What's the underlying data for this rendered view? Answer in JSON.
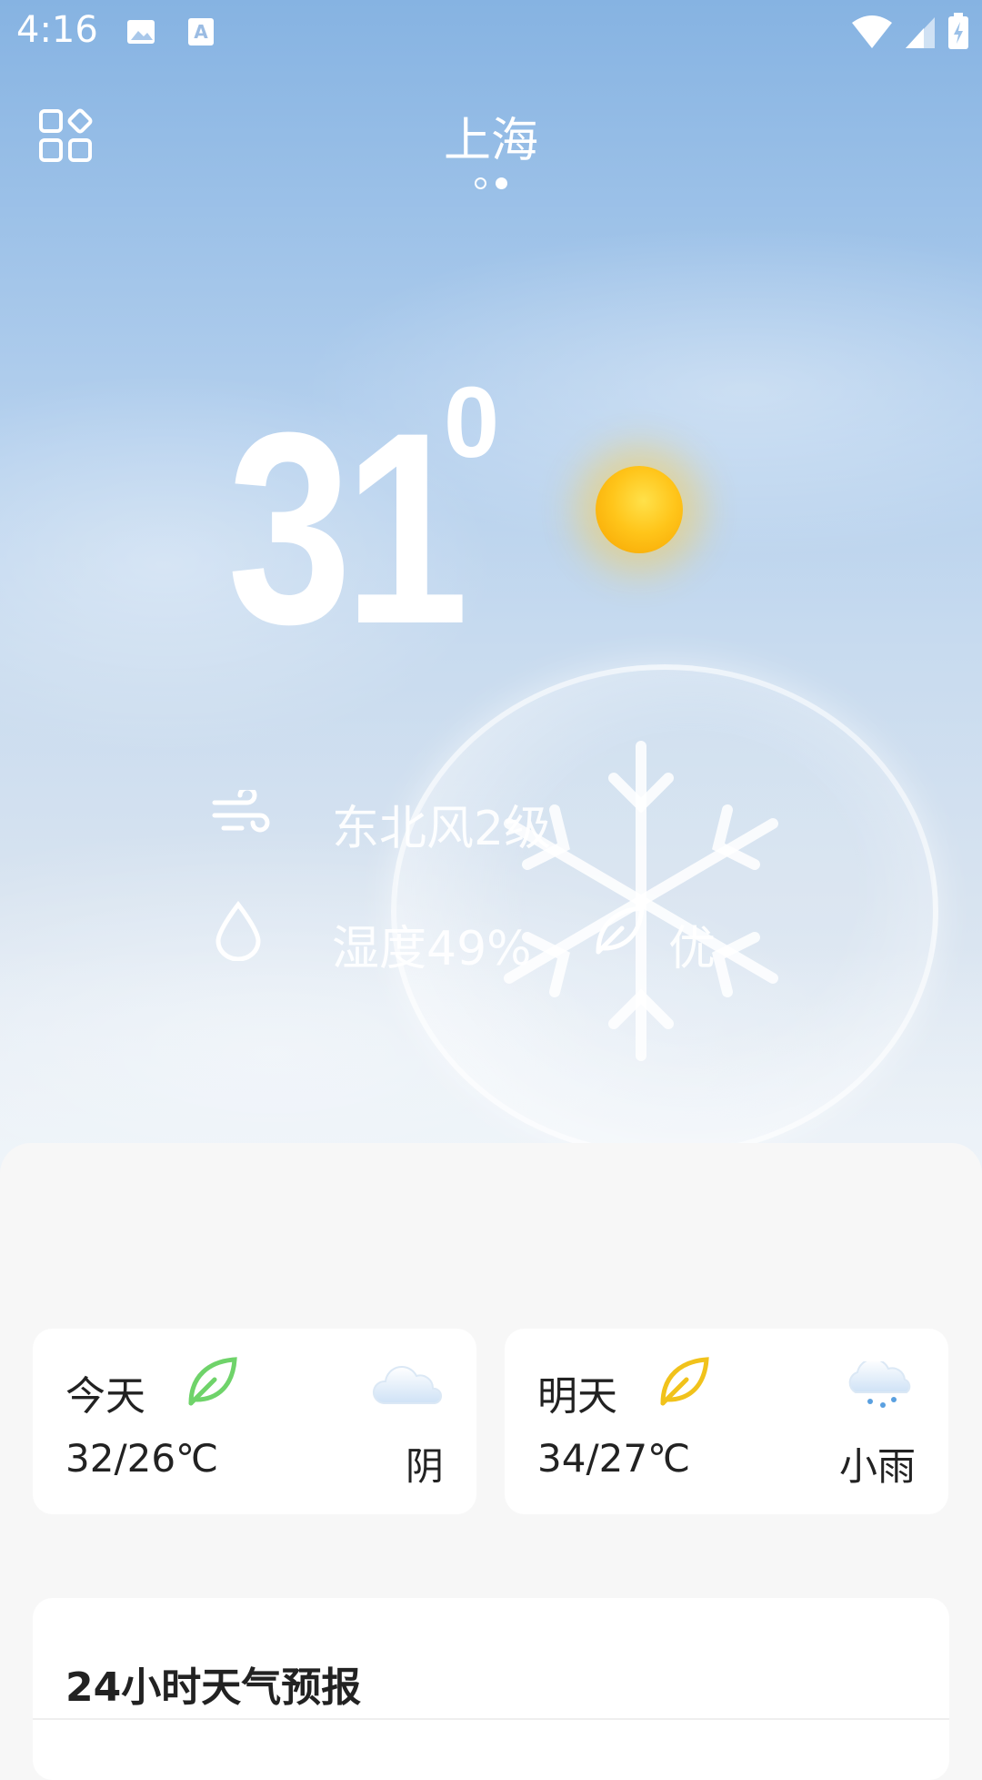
{
  "status_bar": {
    "time": "4:16",
    "icons": [
      "image-icon",
      "a-icon",
      "wifi-icon",
      "signal-icon",
      "battery-charging-icon"
    ]
  },
  "header": {
    "city": "上海",
    "page_indicator": {
      "count": 2,
      "active": 2
    }
  },
  "current": {
    "temperature": "31",
    "degree_symbol": "0",
    "wind": "东北风2级",
    "humidity": "湿度49%",
    "air_quality": "优",
    "condition_icon": "sun-icon"
  },
  "daily": [
    {
      "label": "今天",
      "range": "32/26℃",
      "condition": "阴",
      "leaf_color": "#6fd36a",
      "icon": "cloud-icon"
    },
    {
      "label": "明天",
      "range": "34/27℃",
      "condition": "小雨",
      "leaf_color": "#f1c21b",
      "icon": "light-rain-icon"
    }
  ],
  "forecast": {
    "title": "24小时天气预报"
  }
}
